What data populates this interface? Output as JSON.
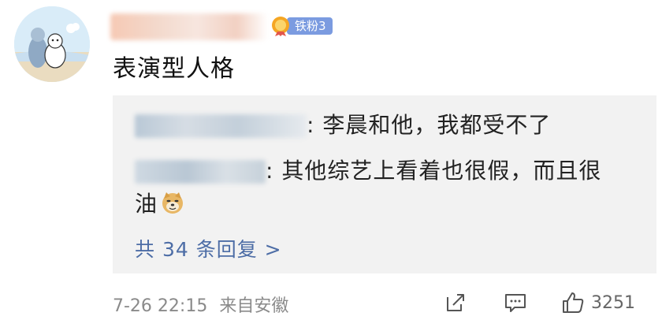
{
  "comment": {
    "fan_badge": "铁粉3",
    "text": "表演型人格"
  },
  "replies": [
    {
      "text": ": 李晨和他，我都受不了"
    },
    {
      "text": ": 其他综艺上看着也很假，而且很",
      "continuation": "油",
      "emoji": "doge-emoji"
    }
  ],
  "reply_count_label": "共 34 条回复 >",
  "meta": {
    "time": "7-26 22:15",
    "source": "来自安徽"
  },
  "actions": {
    "like_count": "3251"
  },
  "colors": {
    "badge": "#7b9be0",
    "link": "#4d6da6",
    "reply_bg": "#f2f2f2",
    "meta": "#8a8a8a"
  }
}
